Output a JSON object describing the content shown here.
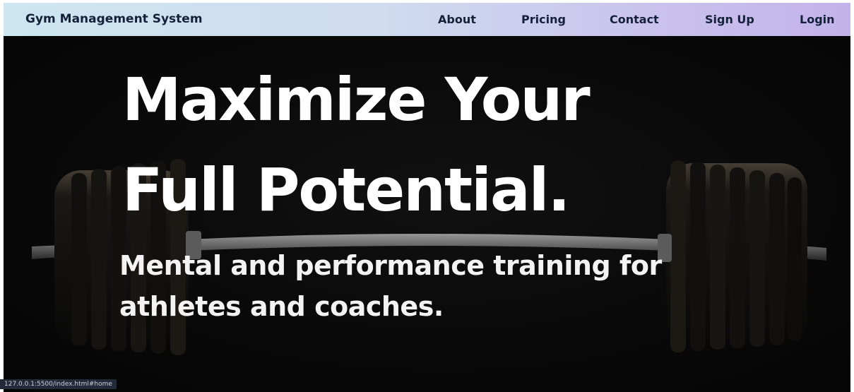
{
  "navbar": {
    "brand": "Gym Management System",
    "links": [
      {
        "label": "About"
      },
      {
        "label": "Pricing"
      },
      {
        "label": "Contact"
      },
      {
        "label": "Sign Up"
      },
      {
        "label": "Login"
      }
    ],
    "gradient_colors": [
      "#cde6f1",
      "#c2b2ea"
    ]
  },
  "hero": {
    "headline_line1": "Maximize Your",
    "headline_line2": "Full Potential.",
    "subheadline_line1": "Mental and performance training for",
    "subheadline_line2": "athletes and coaches.",
    "background_image": "barbell-image"
  },
  "status_bar": {
    "url": "127.0.0.1:5500/index.html#home"
  }
}
